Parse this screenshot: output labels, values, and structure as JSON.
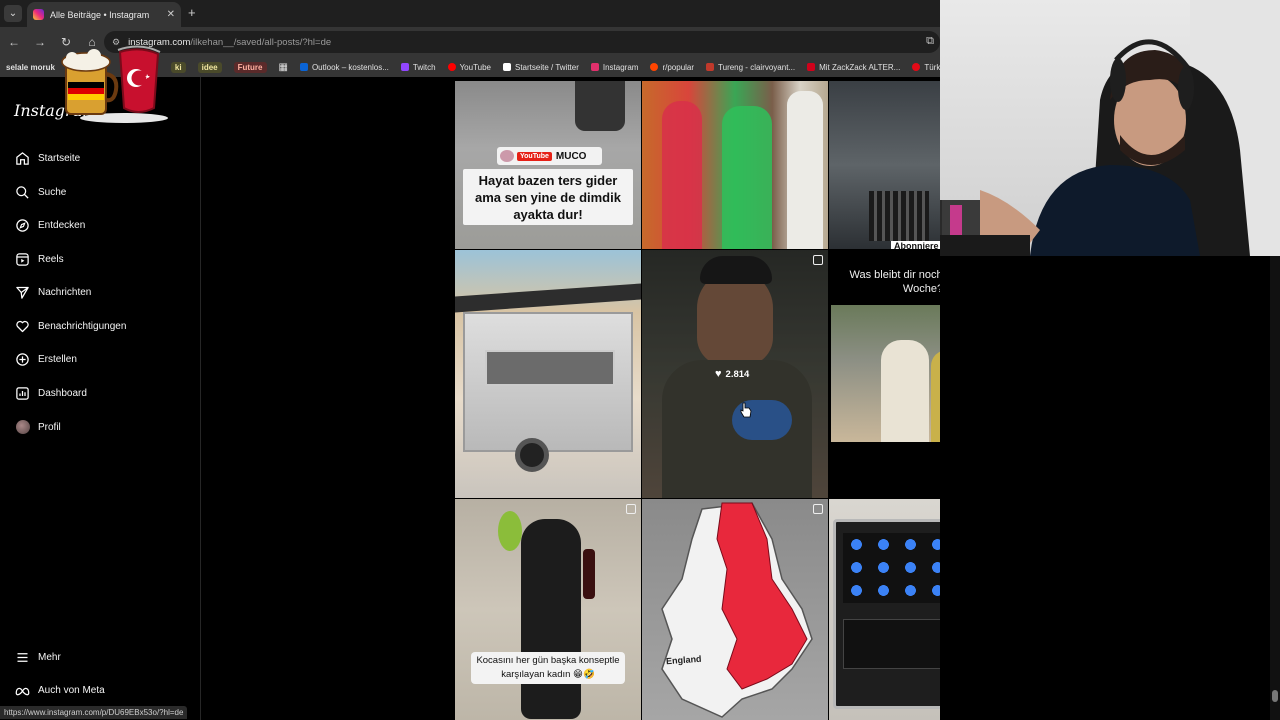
{
  "browser": {
    "tab_title": "Alle Beiträge • Instagram",
    "tab_menu_icon": "chevron-down-icon",
    "url_host": "instagram.com",
    "url_path": "/ilkehan__/saved/all-posts/?hl=de",
    "status_url": "https://www.instagram.com/p/DU69EBx53o/?hl=de"
  },
  "bookmarks": [
    {
      "label": "selale moruk",
      "style": "bold"
    },
    {
      "label": "ki",
      "style": "chip"
    },
    {
      "label": "idee",
      "style": "chip"
    },
    {
      "label": "Future",
      "style": "chip-red"
    },
    {
      "label": "Outlook – kostenlos...",
      "icon": "outlook-icon",
      "color": "#0a64d6"
    },
    {
      "label": "Twitch",
      "icon": "twitch-icon",
      "color": "#9146ff"
    },
    {
      "label": "YouTube",
      "icon": "youtube-icon",
      "color": "#ff0000"
    },
    {
      "label": "Startseite / Twitter",
      "icon": "x-icon",
      "color": "#ffffff"
    },
    {
      "label": "Instagram",
      "icon": "instagram-icon",
      "color": "#e1306c"
    },
    {
      "label": "r/popular",
      "icon": "reddit-icon",
      "color": "#ff4500"
    },
    {
      "label": "Tureng - clairvoyant...",
      "icon": "tureng-icon",
      "color": "#c0392b"
    },
    {
      "label": "Mit ZackZack ALTER...",
      "icon": "zackzack-icon",
      "color": "#d0021b"
    },
    {
      "label": "Türk",
      "icon": "turk-icon",
      "color": "#e30a17"
    }
  ],
  "instagram": {
    "logo_text": "Instagram",
    "nav": [
      {
        "label": "Startseite",
        "icon": "home-icon"
      },
      {
        "label": "Suche",
        "icon": "search-icon"
      },
      {
        "label": "Entdecken",
        "icon": "compass-icon"
      },
      {
        "label": "Reels",
        "icon": "reels-icon"
      },
      {
        "label": "Nachrichten",
        "icon": "send-icon"
      },
      {
        "label": "Benachrichtigungen",
        "icon": "heart-icon"
      },
      {
        "label": "Erstellen",
        "icon": "plus-icon"
      },
      {
        "label": "Dashboard",
        "icon": "dashboard-icon"
      },
      {
        "label": "Profil",
        "icon": "avatar"
      }
    ],
    "bottom_nav": [
      {
        "label": "Mehr",
        "icon": "menu-icon"
      },
      {
        "label": "Auch von Meta",
        "icon": "meta-icon"
      }
    ]
  },
  "posts": {
    "p1_badge": "YouTube",
    "p1_channel": "MUCO",
    "p1_caption": "Hayat bazen ters gider ama sen yine de dimdik ayakta dur!",
    "p3_caption": "Abonniere",
    "p5_likes": "2.814",
    "p6_caption": "Was bleibt dir noch von dieser Woche?",
    "p7_caption": "Kocasını her gün başka konseptle karşılayan kadın 😁🤣",
    "p8_label": "England"
  }
}
